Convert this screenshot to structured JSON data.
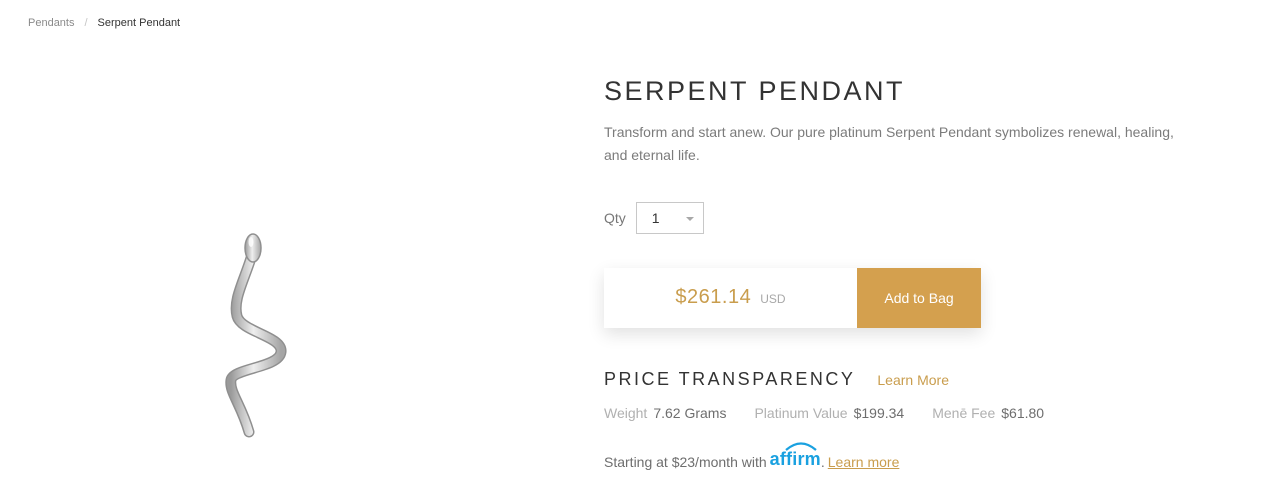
{
  "breadcrumb": {
    "items": [
      {
        "label": "Pendants"
      },
      {
        "label": "Serpent Pendant"
      }
    ],
    "separator": "/"
  },
  "product": {
    "title": "SERPENT PENDANT",
    "description": "Transform and start anew. Our pure platinum Serpent Pendant symbolizes renewal, healing, and eternal life.",
    "image_icon": "serpent-pendant-image"
  },
  "qty": {
    "label": "Qty",
    "value": "1"
  },
  "purchase": {
    "price": "$261.14",
    "currency": "USD",
    "add_label": "Add to Bag"
  },
  "price_transparency": {
    "title": "PRICE TRANSPARENCY",
    "learn_more": "Learn More",
    "stats": [
      {
        "label": "Weight",
        "value": "7.62 Grams"
      },
      {
        "label": "Platinum Value",
        "value": "$199.34"
      },
      {
        "label": "Menē Fee",
        "value": "$61.80"
      }
    ]
  },
  "affirm": {
    "prefix": "Starting at $23/month with",
    "logo_text": "affirm",
    "period": ".",
    "link": "Learn more"
  },
  "colors": {
    "accent_gold": "#d4a04e",
    "affirm_blue": "#1aa1e0"
  }
}
